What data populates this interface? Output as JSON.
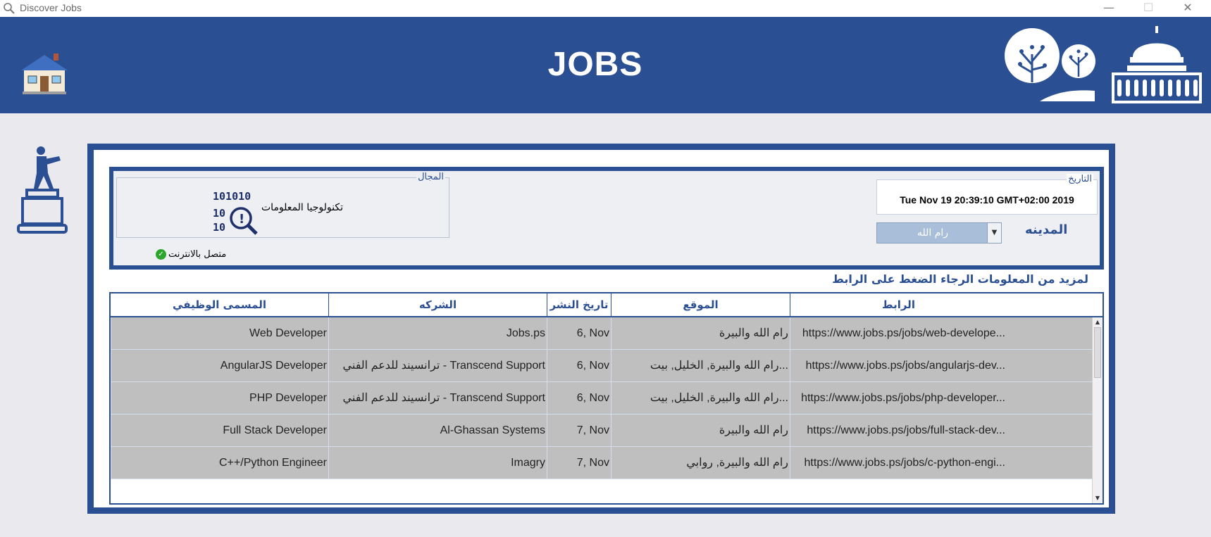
{
  "window": {
    "title": "Discover Jobs",
    "icon": "search-icon",
    "controls": {
      "minimize": "—",
      "maximize": "☐",
      "close": "✕"
    }
  },
  "header": {
    "title": "JOBS",
    "home_icon": "house-icon",
    "trees_icon": "trees-icon",
    "mosque_icon": "dome-of-the-rock-icon",
    "background": "#2b4f93"
  },
  "side_icon": "statue-icon",
  "filters": {
    "field": {
      "legend": "المجال",
      "value": "تكنولوجيا المعلومات",
      "icon": "binary-magnifier-icon"
    },
    "online_status": "متصل بالانترنت",
    "date": {
      "legend": "التاريخ",
      "value": "Tue Nov 19 20:39:10 GMT+02:00 2019"
    },
    "city": {
      "label": "المدينه",
      "value": "رام الله"
    }
  },
  "info_text": "لمزيد من المعلومات الرجاء الضغط على الرابط",
  "table": {
    "headers": {
      "link": "الرابط",
      "location": "الموقع",
      "posted": "تاريخ النشر",
      "company": "الشركه",
      "title": "المسمى الوظيفي"
    },
    "rows": [
      {
        "link": "https://www.jobs.ps/jobs/web-develope...",
        "location": "رام الله والبيرة",
        "posted": "6, Nov",
        "company": "Jobs.ps",
        "title": "Web Developer"
      },
      {
        "link": "https://www.jobs.ps/jobs/angularjs-dev...",
        "location": "رام الله والبيرة, الخليل, بيت...",
        "posted": "6, Nov",
        "company": "ترانسيند للدعم الفني - Transcend Support",
        "title": "AngularJS Developer"
      },
      {
        "link": "https://www.jobs.ps/jobs/php-developer...",
        "location": "رام الله والبيرة, الخليل, بيت...",
        "posted": "6, Nov",
        "company": "ترانسيند للدعم الفني - Transcend Support",
        "title": "PHP Developer"
      },
      {
        "link": "https://www.jobs.ps/jobs/full-stack-dev...",
        "location": "رام الله والبيرة",
        "posted": "7, Nov",
        "company": "Al-Ghassan Systems",
        "title": "Full Stack Developer"
      },
      {
        "link": "https://www.jobs.ps/jobs/c-python-engi...",
        "location": "رام الله والبيرة, روابي",
        "posted": "7, Nov",
        "company": "Imagry",
        "title": "C++/Python Engineer"
      }
    ]
  }
}
